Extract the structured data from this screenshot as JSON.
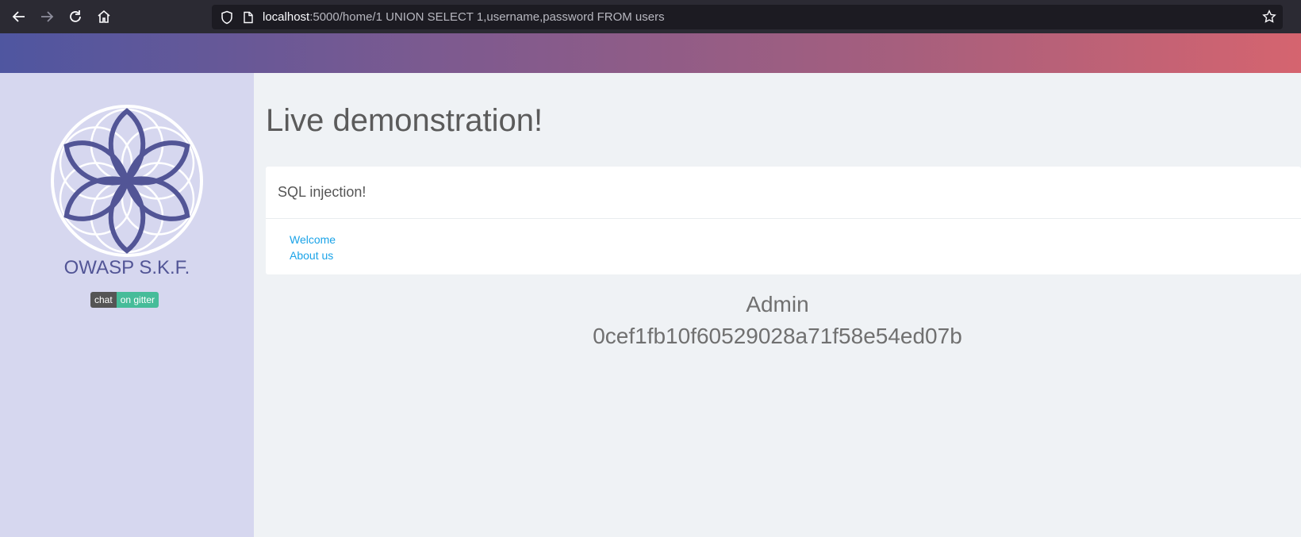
{
  "browser": {
    "url_host": "localhost",
    "url_rest": ":5000/home/1 UNION SELECT 1,username,password FROM users"
  },
  "sidebar": {
    "brand": "OWASP S.K.F.",
    "badge_left": "chat",
    "badge_right": "on gitter"
  },
  "main": {
    "title": "Live demonstration!",
    "card_header": "SQL injection!",
    "links": [
      "Welcome",
      "About us"
    ],
    "result_user": "Admin",
    "result_hash": "0cef1fb10f60529028a71f58e54ed07b"
  },
  "colors": {
    "accent": "#525596",
    "link": "#1aa3e8"
  }
}
